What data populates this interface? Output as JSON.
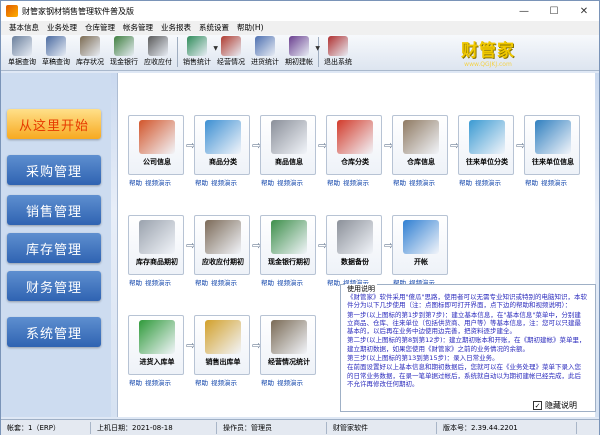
{
  "window": {
    "title": "财管家钢材销售管理软件普及版",
    "min": "—",
    "max": "☐",
    "close": "✕"
  },
  "menubar": [
    "基本信息",
    "业务处理",
    "仓库管理",
    "帐务管理",
    "业务报表",
    "系统设置",
    "帮助(H)"
  ],
  "toolbar": [
    {
      "label": "单据查询",
      "icon": "magnifier-icon",
      "color": "#6a7f9c"
    },
    {
      "label": "草稿查询",
      "icon": "draft-icon",
      "color": "#4a6aa0"
    },
    {
      "label": "库存状况",
      "icon": "warehouse-icon",
      "color": "#7c6b52"
    },
    {
      "label": "现金银行",
      "icon": "bank-icon",
      "color": "#3f7f3f"
    },
    {
      "label": "应收应付",
      "icon": "ledger-icon",
      "color": "#5a5a5a"
    },
    {
      "label": "销售统计",
      "icon": "bar-chart-icon",
      "color": "#2f8c5a",
      "dropdown": true
    },
    {
      "label": "经营情况",
      "icon": "books-icon",
      "color": "#b03b2f"
    },
    {
      "label": "进货统计",
      "icon": "stats-icon",
      "color": "#4d6fb0"
    },
    {
      "label": "期初建帐",
      "icon": "setup-icon",
      "color": "#6a3f8f",
      "dropdown": true
    },
    {
      "label": "退出系统",
      "icon": "exit-icon",
      "color": "#b03030"
    }
  ],
  "logo": {
    "main": "财管家",
    "url": "www.QGJKJ.com"
  },
  "sidebar": [
    "从这里开始",
    "采购管理",
    "销售管理",
    "库存管理",
    "财务管理",
    "系统管理"
  ],
  "tiles_row1": [
    {
      "label": "公司信息",
      "color": "#d2552a"
    },
    {
      "label": "商品分类",
      "color": "#3c8fd2"
    },
    {
      "label": "商品信息",
      "color": "#8a8f99"
    },
    {
      "label": "仓库分类",
      "color": "#d23a2a"
    },
    {
      "label": "仓库信息",
      "color": "#8f7a62"
    },
    {
      "label": "往来单位分类",
      "color": "#3a9ad2"
    },
    {
      "label": "往来单位信息",
      "color": "#2f7fbf"
    }
  ],
  "tiles_row2": [
    {
      "label": "库存商品期初",
      "color": "#9aa2ad"
    },
    {
      "label": "应收应付期初",
      "color": "#7c6a58"
    },
    {
      "label": "现金银行期初",
      "color": "#3d8f4a"
    },
    {
      "label": "数据备份",
      "color": "#8b9099"
    },
    {
      "label": "开帐",
      "color": "#2f7fd2"
    }
  ],
  "tiles_row3": [
    {
      "label": "进货入库单",
      "color": "#2f9a3a"
    },
    {
      "label": "销售出库单",
      "color": "#d2a02a"
    },
    {
      "label": "经营情况统计",
      "color": "#7a6a55"
    }
  ],
  "links": {
    "help": "帮助",
    "video": "视频演示"
  },
  "help": {
    "title": "使用说明",
    "paragraphs": [
      "《财管家》软件采用\"傻瓜\"思路，使用者可以无需专业知识或特别的电脑知识，本软件分为以下几步使用（注：点图标即可打开界面，点下边的帮助和视频说明）：",
      "第一步(以上图标的第1步到第7步)：建立基本信息，在\"基本信息\"菜单中，分别建立商品、仓库、往来单位（包括供货商、用户等）等基本信息，注：您可以只建最基本的，以后再在业务中边使用边完善，把资料逐步建全。",
      "第二步(以上图标的第8到第12步)：建立期初账本和开账，在《期初建帐》菜单里，建立期初数据，如果您使用《财管家》之前的业务情况的余额。",
      "第三步(以上图标的第13到第15步)：录入日常业务。",
      "在前面设置好以上基本信息和期初数据后，您就可以在《业务处理》菜单下录入您的日常业务数据，在录一笔单据过帐后，系统就自动以为期初建帐已经完成，此后不允许再修改任何期初。"
    ],
    "hide_label": "隐藏说明",
    "hide_checked": true
  },
  "status": [
    {
      "label": "帐套",
      "value": "1（ERP）"
    },
    {
      "label": "上机日期",
      "value": "2021-08-18"
    },
    {
      "label": "操作员",
      "value": "管理员"
    },
    {
      "label": "",
      "value": "财管家软件"
    },
    {
      "label": "版本号",
      "value": "2.39.44.2201"
    }
  ]
}
